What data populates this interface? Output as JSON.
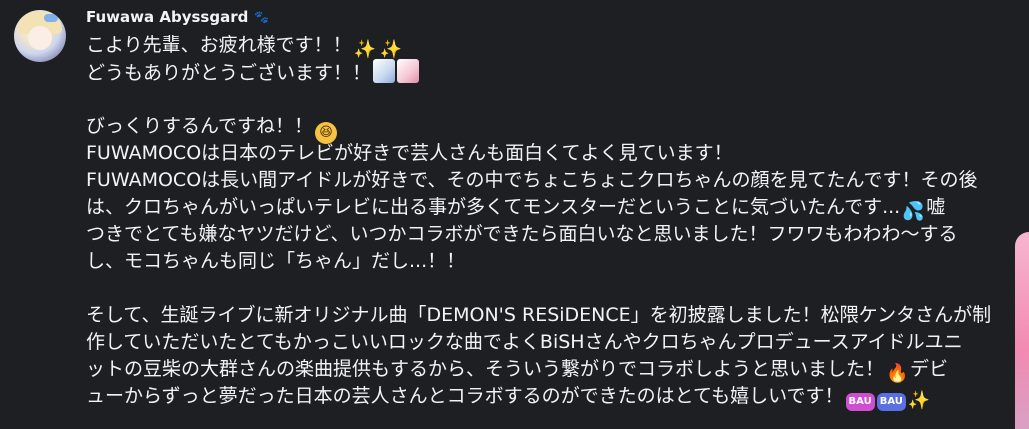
{
  "message": {
    "author": "Fuwawa Abyssgard",
    "author_badge_icon": "paw-icon",
    "lines": [
      "こより先輩、お疲れ様です！！",
      "どうもありがとうございます！！",
      "",
      "びっくりするんですね！！",
      "FUWAMOCOは日本のテレビが好きで芸人さんも面白くてよく見ています！",
      "FUWAMOCOは長い間アイドルが好きで、その中でちょこちょこクロちゃんの顔を見てたんです！その後",
      "は、クロちゃんがいっぱいテレビに出る事が多くてモンスターだということに気づいたんです...",
      "つきでとても嫌なヤツだけど、いつかコラボができたら面白いなと思いました！フワワもわわわ～する",
      "し、モコちゃんも同じ「ちゃん」だし...！！",
      "",
      "そして、生誕ライブに新オリジナル曲「DEMON'S RESiDENCE」を初披露しました！松隈ケンタさんが制",
      "作していただいたとてもかっこいいロックな曲でよくBiSHさんやクロちゃんプロデュースアイドルユニ",
      "ットの豆柴の大群さんの楽曲提供もするから、そういう繋がりでコラボしようと思いました！",
      "ューからずっと夢だった日本の芸人さんとコラボするのができたのはとても嬉しいです！"
    ],
    "trailing_text": {
      "line7": "嘘",
      "line13": "デビ"
    },
    "emoji_glyphs": {
      "sparkle": "✨",
      "laugh": "😆",
      "sweat": "💦",
      "fire": "🔥",
      "paw": "🐾"
    },
    "sticker_label": "BAU"
  }
}
